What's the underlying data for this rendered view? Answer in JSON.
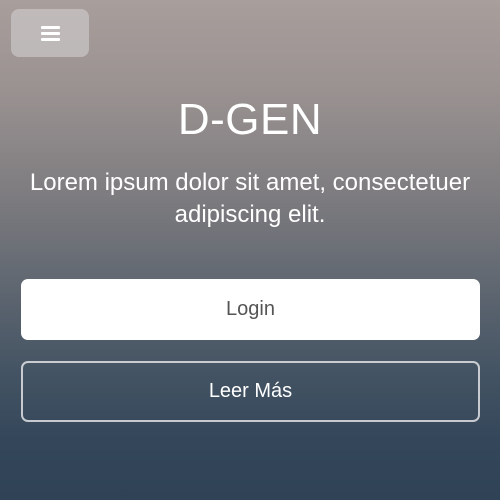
{
  "header": {
    "menu_icon": "hamburger-menu-icon"
  },
  "hero": {
    "title": "D-GEN",
    "subtitle": "Lorem ipsum dolor sit amet, consectetuer adipiscing elit."
  },
  "actions": {
    "login_label": "Login",
    "more_label": "Leer Más"
  },
  "colors": {
    "primary_button_bg": "#ffffff",
    "primary_button_text": "#555555",
    "text": "#ffffff"
  }
}
